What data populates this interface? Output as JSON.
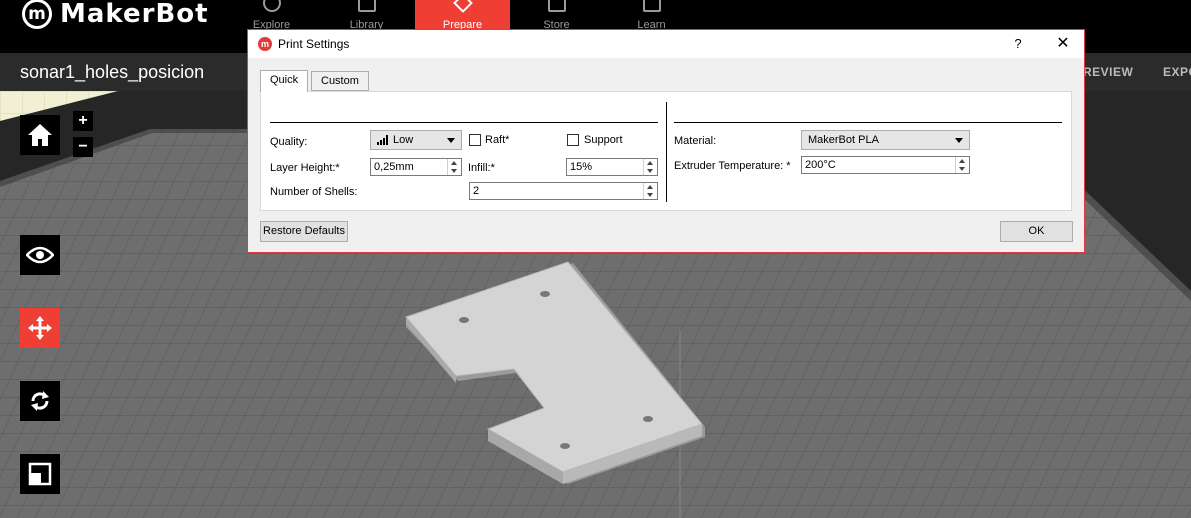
{
  "app": {
    "brand": "MakerBot",
    "logo_letter": "m"
  },
  "nav": {
    "tabs": [
      {
        "label": "Explore",
        "active": false
      },
      {
        "label": "Library",
        "active": false
      },
      {
        "label": "Prepare",
        "active": true
      },
      {
        "label": "Store",
        "active": false
      },
      {
        "label": "Learn",
        "active": false
      }
    ]
  },
  "file": {
    "name": "sonar1_holes_posicion"
  },
  "actions": {
    "preview": "REVIEW",
    "export": "EXPO"
  },
  "tools": {
    "zoom_in": "+",
    "zoom_out": "−"
  },
  "dialog": {
    "title": "Print Settings",
    "help": "?",
    "close": "✕",
    "tabs": [
      {
        "label": "Quick",
        "selected": true
      },
      {
        "label": "Custom",
        "selected": false
      }
    ],
    "quality": {
      "label": "Quality:",
      "value": "Low",
      "icon": "bars-icon"
    },
    "raft": {
      "label": "Raft*",
      "checked": false
    },
    "support": {
      "label": "Support",
      "checked": false
    },
    "layer_height": {
      "label": "Layer Height:*",
      "value": "0,25mm"
    },
    "infill": {
      "label": "Infill:*",
      "value": "15%"
    },
    "shells": {
      "label": "Number of Shells:",
      "value": "2"
    },
    "material": {
      "label": "Material:",
      "value": "MakerBot PLA"
    },
    "extruder_temp": {
      "label": "Extruder Temperature: *",
      "value": "200°C"
    },
    "restore_defaults": "Restore Defaults",
    "ok": "OK"
  },
  "colors": {
    "accent": "#ef3e33",
    "platform": "#6e6e6e",
    "model": "#d4d4d4",
    "background": "#f1efd4"
  }
}
